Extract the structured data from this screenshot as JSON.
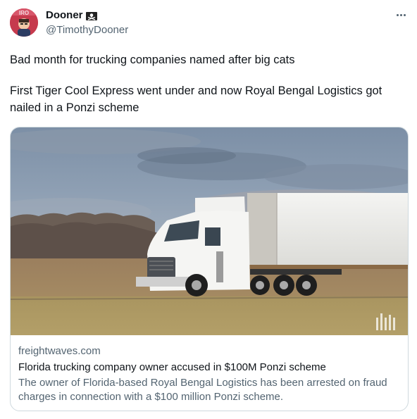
{
  "author": {
    "display_name": "Dooner",
    "handle": "@TimothyDooner",
    "avatar_icon": "profile-avatar",
    "badge_icon": "pirate-flag-icon"
  },
  "menu": {
    "icon": "more-dots-icon"
  },
  "tweet": {
    "paragraphs": [
      "Bad month for trucking companies named after big cats",
      "First Tiger Cool Express went under and now Royal Bengal Logistics got nailed in a Ponzi scheme"
    ]
  },
  "card": {
    "domain": "freightwaves.com",
    "title": "Florida trucking company owner accused in $100M Ponzi scheme",
    "description": "The owner of Florida-based Royal Bengal Logistics has been arrested on fraud charges in connection with a $100 million Ponzi scheme.",
    "image_icon": "semi-truck-photo",
    "watermark_icon": "photo-watermark-icon"
  },
  "colors": {
    "text_primary": "#0f1419",
    "text_secondary": "#536471",
    "border": "#cfd9de"
  }
}
